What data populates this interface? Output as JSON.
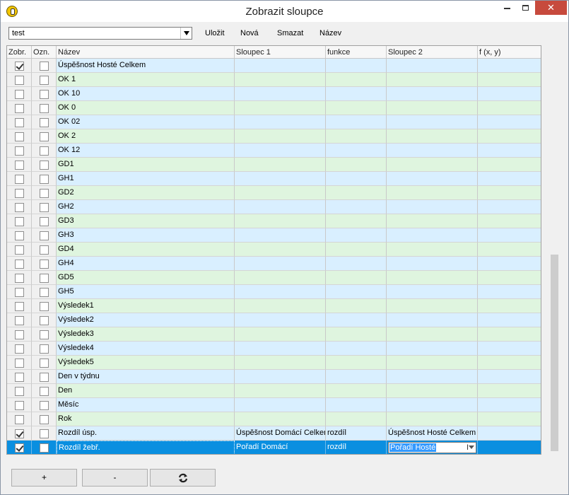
{
  "window": {
    "title": "Zobrazit sloupce",
    "close_glyph": "✕",
    "app_icon": "light-bulb-icon"
  },
  "toolbar": {
    "preset_value": "test",
    "save_label": "Uložit",
    "new_label": "Nová",
    "delete_label": "Smazat",
    "name_label": "Název"
  },
  "grid": {
    "columns": [
      "Zobr.",
      "Ozn.",
      "Název",
      "Sloupec 1",
      "funkce",
      "Sloupec 2",
      "f (x, y)"
    ],
    "rows": [
      {
        "show": true,
        "mark": false,
        "name": "Úspěšnost Hosté Celkem",
        "col1": "",
        "func": "",
        "col2": "",
        "fxy": ""
      },
      {
        "show": false,
        "mark": false,
        "name": "OK 1",
        "col1": "",
        "func": "",
        "col2": "",
        "fxy": ""
      },
      {
        "show": false,
        "mark": false,
        "name": "OK 10",
        "col1": "",
        "func": "",
        "col2": "",
        "fxy": ""
      },
      {
        "show": false,
        "mark": false,
        "name": "OK 0",
        "col1": "",
        "func": "",
        "col2": "",
        "fxy": ""
      },
      {
        "show": false,
        "mark": false,
        "name": "OK 02",
        "col1": "",
        "func": "",
        "col2": "",
        "fxy": ""
      },
      {
        "show": false,
        "mark": false,
        "name": "OK 2",
        "col1": "",
        "func": "",
        "col2": "",
        "fxy": ""
      },
      {
        "show": false,
        "mark": false,
        "name": "OK 12",
        "col1": "",
        "func": "",
        "col2": "",
        "fxy": ""
      },
      {
        "show": false,
        "mark": false,
        "name": "GD1",
        "col1": "",
        "func": "",
        "col2": "",
        "fxy": ""
      },
      {
        "show": false,
        "mark": false,
        "name": "GH1",
        "col1": "",
        "func": "",
        "col2": "",
        "fxy": ""
      },
      {
        "show": false,
        "mark": false,
        "name": "GD2",
        "col1": "",
        "func": "",
        "col2": "",
        "fxy": ""
      },
      {
        "show": false,
        "mark": false,
        "name": "GH2",
        "col1": "",
        "func": "",
        "col2": "",
        "fxy": ""
      },
      {
        "show": false,
        "mark": false,
        "name": "GD3",
        "col1": "",
        "func": "",
        "col2": "",
        "fxy": ""
      },
      {
        "show": false,
        "mark": false,
        "name": "GH3",
        "col1": "",
        "func": "",
        "col2": "",
        "fxy": ""
      },
      {
        "show": false,
        "mark": false,
        "name": "GD4",
        "col1": "",
        "func": "",
        "col2": "",
        "fxy": ""
      },
      {
        "show": false,
        "mark": false,
        "name": "GH4",
        "col1": "",
        "func": "",
        "col2": "",
        "fxy": ""
      },
      {
        "show": false,
        "mark": false,
        "name": "GD5",
        "col1": "",
        "func": "",
        "col2": "",
        "fxy": ""
      },
      {
        "show": false,
        "mark": false,
        "name": "GH5",
        "col1": "",
        "func": "",
        "col2": "",
        "fxy": ""
      },
      {
        "show": false,
        "mark": false,
        "name": "Výsledek1",
        "col1": "",
        "func": "",
        "col2": "",
        "fxy": ""
      },
      {
        "show": false,
        "mark": false,
        "name": "Výsledek2",
        "col1": "",
        "func": "",
        "col2": "",
        "fxy": ""
      },
      {
        "show": false,
        "mark": false,
        "name": "Výsledek3",
        "col1": "",
        "func": "",
        "col2": "",
        "fxy": ""
      },
      {
        "show": false,
        "mark": false,
        "name": "Výsledek4",
        "col1": "",
        "func": "",
        "col2": "",
        "fxy": ""
      },
      {
        "show": false,
        "mark": false,
        "name": "Výsledek5",
        "col1": "",
        "func": "",
        "col2": "",
        "fxy": ""
      },
      {
        "show": false,
        "mark": false,
        "name": "Den v týdnu",
        "col1": "",
        "func": "",
        "col2": "",
        "fxy": ""
      },
      {
        "show": false,
        "mark": false,
        "name": "Den",
        "col1": "",
        "func": "",
        "col2": "",
        "fxy": ""
      },
      {
        "show": false,
        "mark": false,
        "name": "Měsíc",
        "col1": "",
        "func": "",
        "col2": "",
        "fxy": ""
      },
      {
        "show": false,
        "mark": false,
        "name": "Rok",
        "col1": "",
        "func": "",
        "col2": "",
        "fxy": ""
      },
      {
        "show": true,
        "mark": false,
        "name": "Rozdíl úsp.",
        "col1": "Úspěšnost Domácí Celkem",
        "func": "rozdíl",
        "col2": "Úspěšnost Hosté Celkem",
        "fxy": ""
      },
      {
        "show": true,
        "mark": false,
        "name": "Rozdíl žebř.",
        "col1": "Pořadí Domácí",
        "func": "rozdíl",
        "col2": "Pořadí Hosté",
        "fxy": "",
        "selected": true,
        "editing": true
      }
    ]
  },
  "buttons": {
    "add_label": "+",
    "remove_label": "-",
    "refresh_icon": "refresh-icon"
  }
}
